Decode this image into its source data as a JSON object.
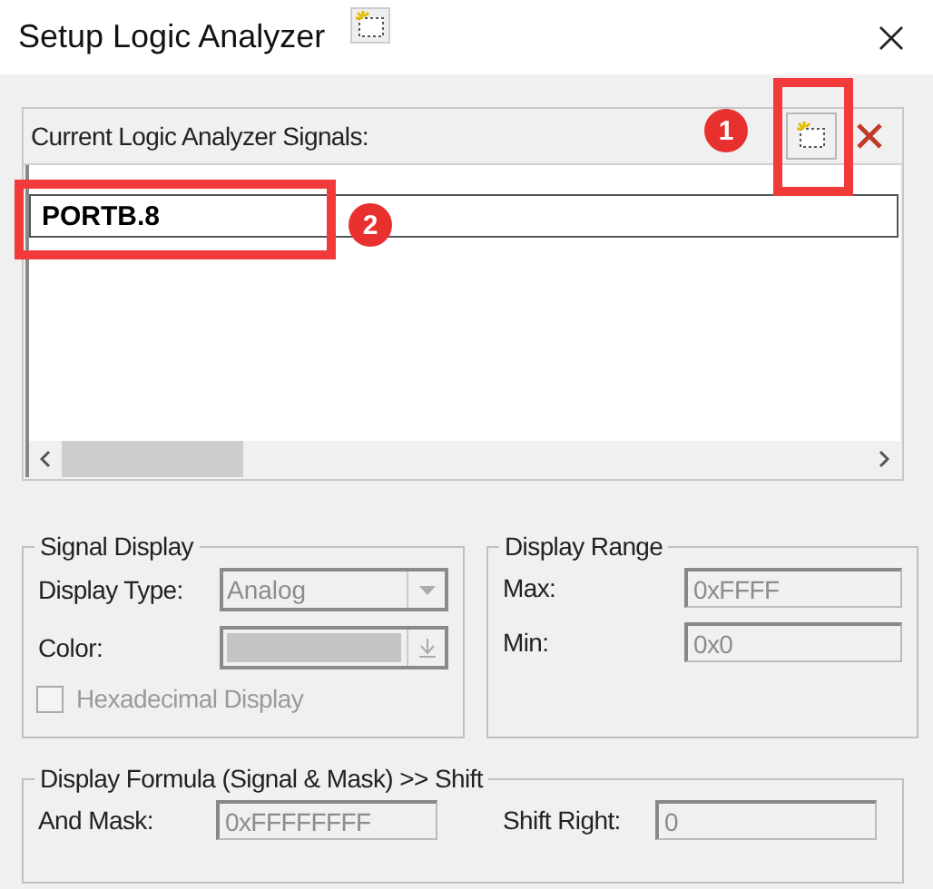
{
  "window": {
    "title": "Setup Logic Analyzer"
  },
  "signals": {
    "label": "Current Logic Analyzer Signals:",
    "items": [
      {
        "name": "PORTB.8",
        "editing": true
      }
    ]
  },
  "signal_display": {
    "title": "Signal Display",
    "display_type": {
      "label": "Display Type:",
      "value": "Analog",
      "disabled": true
    },
    "color": {
      "label": "Color:",
      "disabled": true
    },
    "hexadecimal": {
      "label": "Hexadecimal Display",
      "checked": false,
      "disabled": true
    }
  },
  "display_range": {
    "title": "Display Range",
    "max": {
      "label": "Max:",
      "value": "0xFFFF",
      "disabled": true
    },
    "min": {
      "label": "Min:",
      "value": "0x0",
      "disabled": true
    }
  },
  "formula": {
    "title": "Display Formula (Signal & Mask) >> Shift",
    "and_mask": {
      "label": "And Mask:",
      "value": "0xFFFFFFFF",
      "disabled": true
    },
    "shift_right": {
      "label": "Shift Right:",
      "value": "0",
      "disabled": true
    }
  },
  "annotations": [
    {
      "number": "1"
    },
    {
      "number": "2"
    }
  ]
}
